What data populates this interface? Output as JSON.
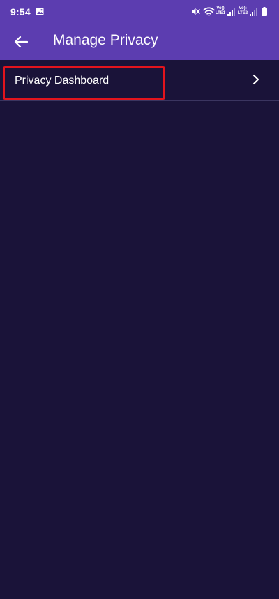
{
  "status_bar": {
    "time": "9:54",
    "volte1_top": "Vo))",
    "volte1_bottom": "LTE1",
    "volte2_top": "Vo))",
    "volte2_bottom": "LTE2",
    "icons": [
      "gallery-icon",
      "mute-icon",
      "wifi-icon",
      "signal-icon",
      "battery-icon"
    ]
  },
  "app_bar": {
    "title": "Manage Privacy",
    "back_icon": "arrow-left-icon"
  },
  "list": {
    "items": [
      {
        "label": "Privacy Dashboard",
        "icon": "chevron-right-icon"
      }
    ]
  },
  "colors": {
    "app_bar": "#5c3db0",
    "background": "#1a1339",
    "divider": "#3b3560",
    "highlight": "#e3141d",
    "text": "#ffffff"
  }
}
